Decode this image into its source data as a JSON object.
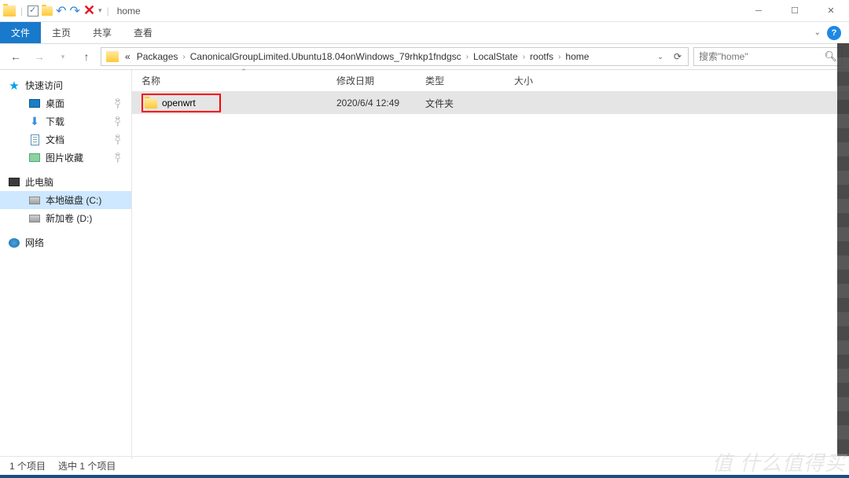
{
  "title_bar": {
    "title": "home"
  },
  "ribbon": {
    "file": "文件",
    "home": "主页",
    "share": "共享",
    "view": "查看"
  },
  "breadcrumb": {
    "prefix": "«",
    "segments": [
      "Packages",
      "CanonicalGroupLimited.Ubuntu18.04onWindows_79rhkp1fndgsc",
      "LocalState",
      "rootfs",
      "home"
    ]
  },
  "search": {
    "placeholder": "搜索\"home\""
  },
  "sidebar": {
    "quick_access": "快速访问",
    "desktop": "桌面",
    "downloads": "下载",
    "documents": "文档",
    "pictures": "图片收藏",
    "this_pc": "此电脑",
    "local_disk": "本地磁盘 (C:)",
    "new_volume": "新加卷 (D:)",
    "network": "网络"
  },
  "columns": {
    "name": "名称",
    "date": "修改日期",
    "type": "类型",
    "size": "大小"
  },
  "files": [
    {
      "name": "openwrt",
      "date": "2020/6/4 12:49",
      "type": "文件夹",
      "size": ""
    }
  ],
  "status": {
    "count": "1 个项目",
    "selected": "选中 1 个项目"
  },
  "watermark": "值 什么值得买"
}
